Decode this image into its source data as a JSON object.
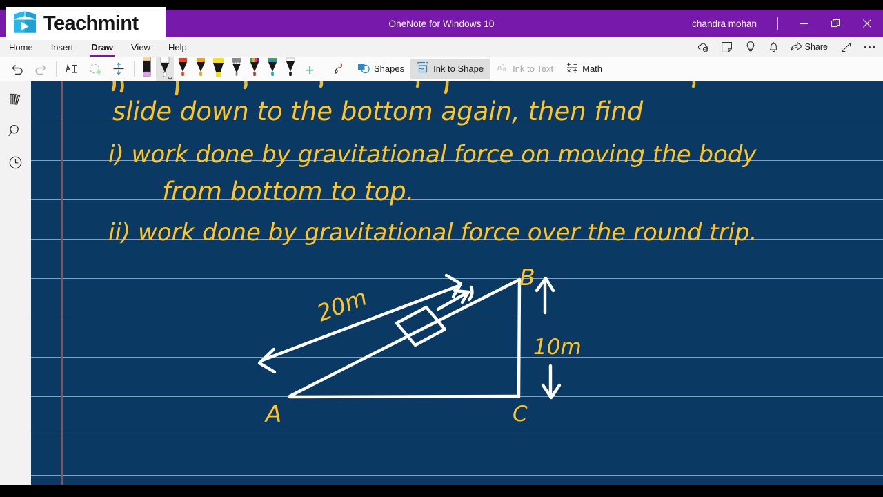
{
  "window": {
    "title": "OneNote for Windows 10",
    "user": "chandra mohan",
    "controls": [
      {
        "name": "minimize",
        "label": "Minimize"
      },
      {
        "name": "restore",
        "label": "Restore"
      },
      {
        "name": "close",
        "label": "Close"
      }
    ]
  },
  "brand": {
    "overlay_name": "Teachmint",
    "logo_color": "#29b6e8"
  },
  "ribbon": {
    "tabs": [
      {
        "label": "Home",
        "active": false
      },
      {
        "label": "Insert",
        "active": false
      },
      {
        "label": "Draw",
        "active": true
      },
      {
        "label": "View",
        "active": false
      },
      {
        "label": "Help",
        "active": false
      }
    ],
    "active_tab": "Draw",
    "accent_color": "#7719aa",
    "right_icons": [
      {
        "name": "sync-cloud-icon",
        "label": "Sync status"
      },
      {
        "name": "sticky-note-icon",
        "label": "New note"
      },
      {
        "name": "lightbulb-icon",
        "label": "Tell me what you want to do"
      },
      {
        "name": "bell-icon",
        "label": "Notifications"
      }
    ],
    "share_label": "Share",
    "expand_label": "Full screen",
    "more_label": "More options"
  },
  "draw_toolbar": {
    "undo_label": "Undo",
    "redo_label": "Redo",
    "lasso_label": "Lasso Select",
    "add_space_label": "Insert Space",
    "ruler_label": "Ruler",
    "pens": [
      {
        "name": "eraser",
        "label": "Eraser",
        "color": "#d6a8e0",
        "selected": false
      },
      {
        "name": "pen-white",
        "label": "Pen - white",
        "color": "#ffffff",
        "selected": true
      },
      {
        "name": "pen-red-orange",
        "label": "Pen - red orange",
        "color": "#e8441c",
        "selected": false
      },
      {
        "name": "pen-orange",
        "label": "Pen - orange",
        "color": "#f0a512",
        "selected": false
      },
      {
        "name": "highlighter-yellow",
        "label": "Highlighter - yellow",
        "color": "#f7e11e",
        "selected": false
      },
      {
        "name": "pencil-gray",
        "label": "Pencil - gray",
        "color": "#8a8a8a",
        "selected": false
      },
      {
        "name": "pen-rainbow",
        "label": "Pen - rainbow",
        "color": "#2fae4f",
        "selected": false
      },
      {
        "name": "pen-galaxy",
        "label": "Pen - galaxy",
        "color": "#2f86c9",
        "selected": false
      },
      {
        "name": "pen-black",
        "label": "Pen - black",
        "color": "#1a1a1a",
        "selected": false
      }
    ],
    "add_pen_label": "+",
    "ink_tools": [
      {
        "name": "shapes",
        "label": "Shapes",
        "active": false,
        "disabled": false
      },
      {
        "name": "ink-to-shape",
        "label": "Ink to Shape",
        "active": true,
        "disabled": false
      },
      {
        "name": "ink-to-text",
        "label": "Ink to Text",
        "active": false,
        "disabled": true
      },
      {
        "name": "math",
        "label": "Math",
        "active": false,
        "disabled": false
      }
    ]
  },
  "sidebar": {
    "items": [
      {
        "name": "notebooks",
        "label": "Notebooks"
      },
      {
        "name": "search",
        "label": "Search"
      },
      {
        "name": "recent",
        "label": "Recent Notes"
      }
    ]
  },
  "page": {
    "background_color": "#0a3a63",
    "rule_color": "#a8c6e2",
    "margin_line_color": "#9e4a44",
    "ink_color_text": "#ffc425",
    "ink_color_diagram": "#ffffff",
    "handwriting": [
      "slide down to the bottom again, then find",
      "i) work done by gravitational force on moving the body",
      "from bottom to top.",
      "ii) work done by gravitational force over the round trip."
    ],
    "diagram": {
      "description": "Right triangle inclined plane with block",
      "vertices": [
        "A",
        "B",
        "C"
      ],
      "labels": [
        {
          "text": "20m",
          "meaning": "length of incline AB"
        },
        {
          "text": "10m",
          "meaning": "height BC"
        },
        {
          "text": "A",
          "meaning": "bottom-left vertex"
        },
        {
          "text": "B",
          "meaning": "top-right vertex"
        },
        {
          "text": "C",
          "meaning": "bottom-right vertex"
        }
      ]
    }
  }
}
